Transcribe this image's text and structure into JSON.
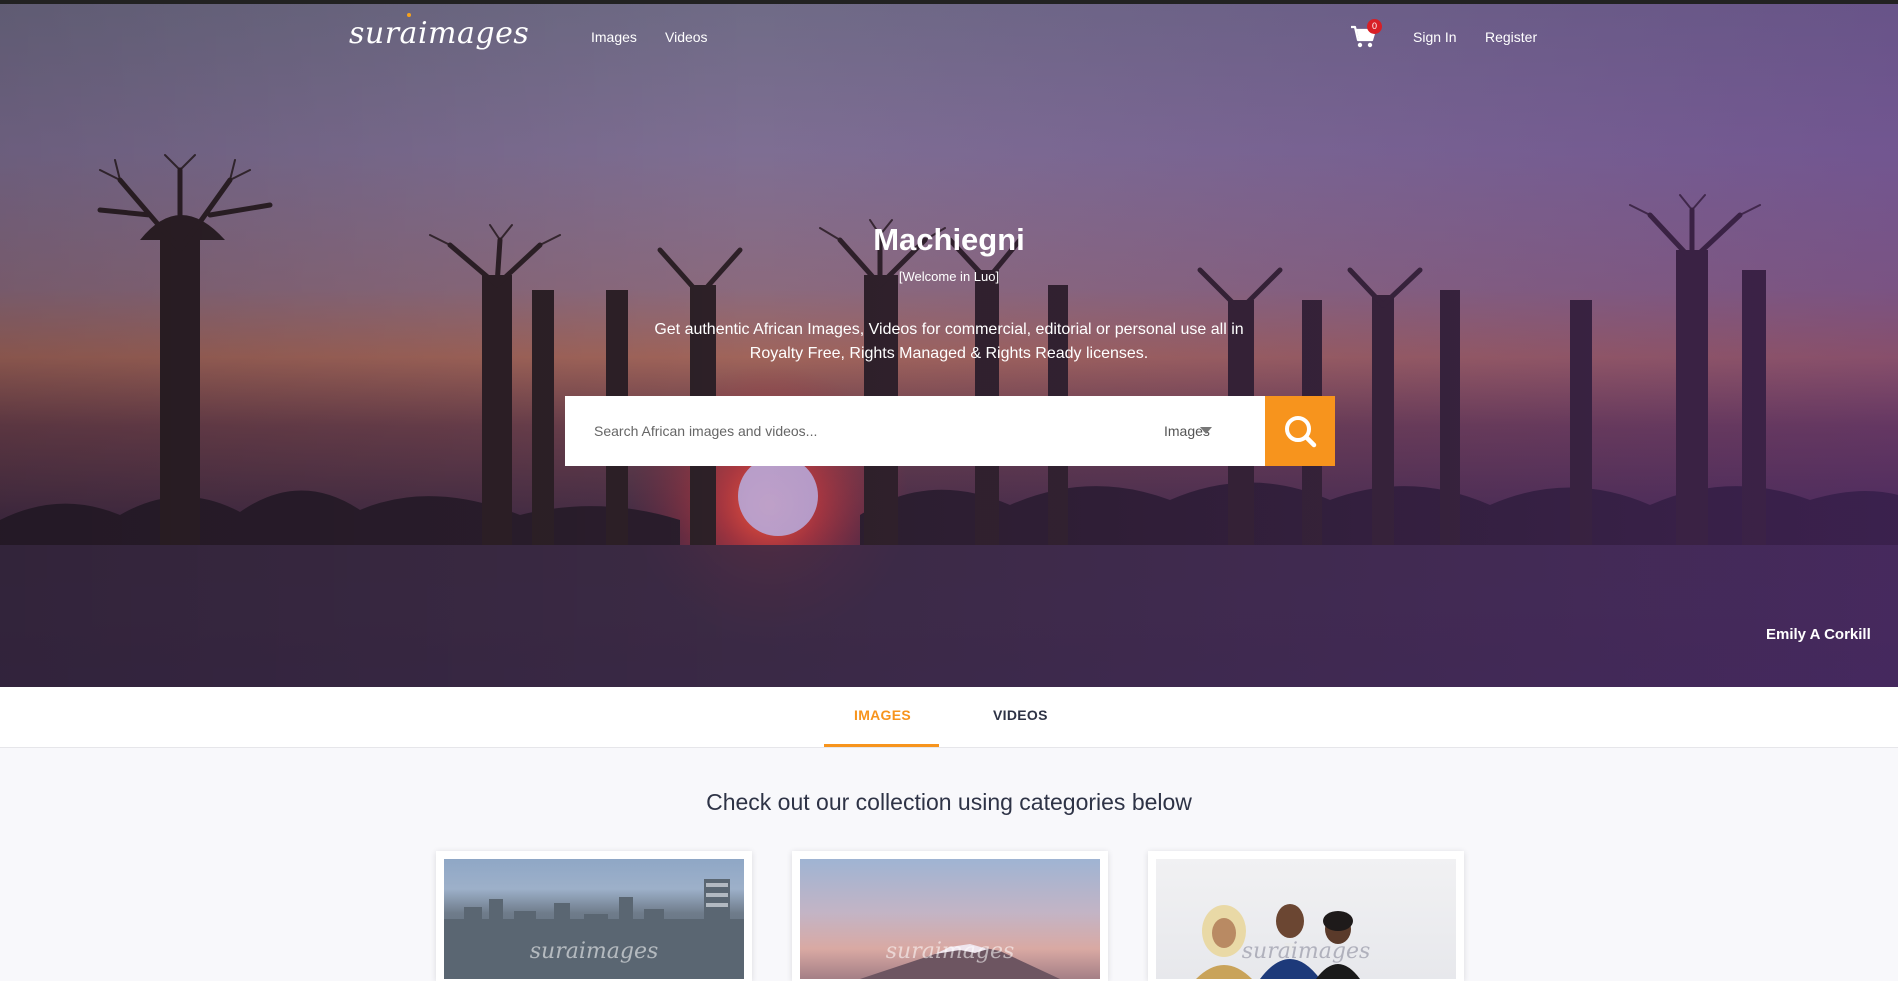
{
  "nav": {
    "logo": "suraimages",
    "links": {
      "images": "Images",
      "videos": "Videos"
    },
    "cart_count": "0",
    "sign_in": "Sign In",
    "register": "Register"
  },
  "hero": {
    "title": "Machiegni",
    "subtitle": "[Welcome in Luo]",
    "description": "Get authentic African Images, Videos for commercial, editorial or personal use all in Royalty Free, Rights Managed & Rights Ready licenses.",
    "search": {
      "placeholder": "Search African images and videos...",
      "type_selected": "Images"
    },
    "photo_credit": "Emily A Corkill"
  },
  "tabs": [
    {
      "label": "IMAGES",
      "active": true
    },
    {
      "label": "VIDEOS",
      "active": false
    }
  ],
  "collection": {
    "heading": "Check out our collection using categories below",
    "watermark": "suraimages"
  },
  "colors": {
    "accent": "#f7941d",
    "text_dark": "#2e3346",
    "badge": "#d81f26"
  }
}
